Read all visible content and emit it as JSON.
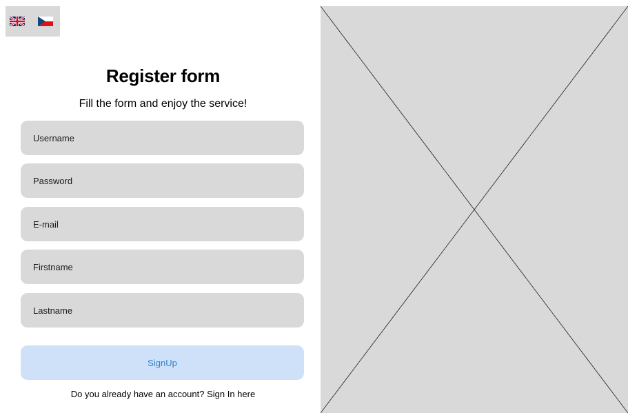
{
  "languages": [
    {
      "code": "en-GB",
      "icon": "uk-flag-icon"
    },
    {
      "code": "cs",
      "icon": "czech-flag-icon"
    }
  ],
  "form": {
    "title": "Register form",
    "subtitle": "Fill the form and enjoy the service!",
    "fields": {
      "username": {
        "placeholder": "Username",
        "value": ""
      },
      "password": {
        "placeholder": "Password",
        "value": ""
      },
      "email": {
        "placeholder": "E-mail",
        "value": ""
      },
      "firstname": {
        "placeholder": "Firstname",
        "value": ""
      },
      "lastname": {
        "placeholder": "Lastname",
        "value": ""
      }
    },
    "submit_label": "SignUp",
    "signin_text": "Do you already have an account? Sign In here"
  },
  "image_placeholder": {
    "icon": "image-placeholder-icon"
  },
  "colors": {
    "field_bg": "#d9d9d9",
    "button_bg": "#cfe1f9",
    "button_text": "#2f80c8",
    "placeholder_bg": "#d9d9d9"
  }
}
